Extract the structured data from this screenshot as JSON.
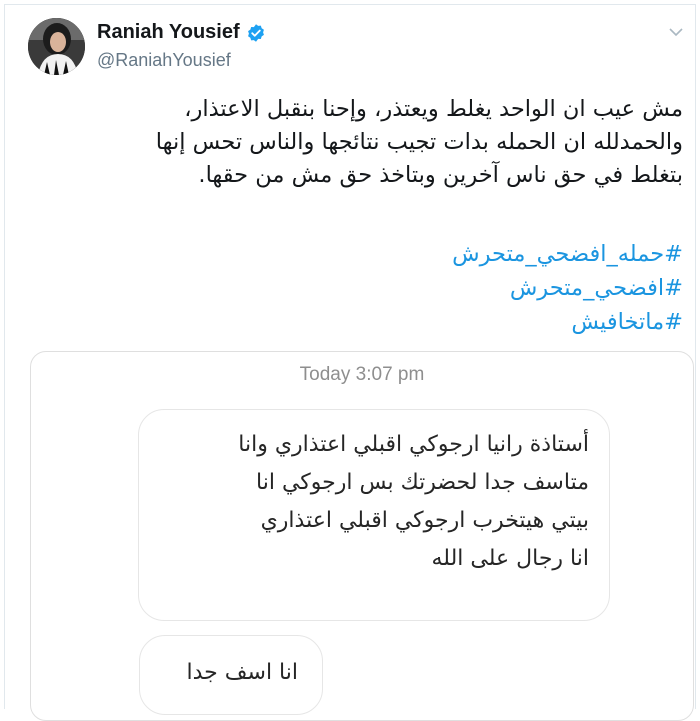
{
  "author": {
    "display_name": "Raniah Yousief",
    "handle": "@RaniahYousief",
    "verified": true,
    "avatar_icon": "profile-photo",
    "verified_icon": "verified-badge-icon",
    "menu_icon": "chevron-down-icon"
  },
  "tweet": {
    "text_lines": [
      "مش عيب ان الواحد يغلط ويعتذر، وإحنا بنقبل الاعتذار،",
      "والحمدلله ان الحمله بدات تجيب نتائجها والناس تحس إنها",
      "بتغلط في حق ناس آخرين وبتاخذ حق مش من حقها."
    ],
    "hashtags": [
      "#حمله_افضحي_متحرش",
      "#افضحي_متحرش",
      "#ماتخافيش"
    ]
  },
  "attached_screenshot": {
    "timestamp": "Today 3:07 pm",
    "messages": [
      {
        "lines": [
          "أستاذة رانيا ارجوكي اقبلي اعتذاري وانا",
          "متاسف جدا لحضرتك بس ارجوكي انا",
          "بيتي هيتخرب  ارجوكي اقبلي اعتذاري",
          "انا رجال على الله"
        ]
      },
      {
        "lines": [
          "انا اسف جدا"
        ]
      }
    ]
  },
  "colors": {
    "link": "#1b95e0",
    "verified": "#1da1f2",
    "secondary_text": "#657786",
    "timestamp": "#8e8e8e"
  }
}
